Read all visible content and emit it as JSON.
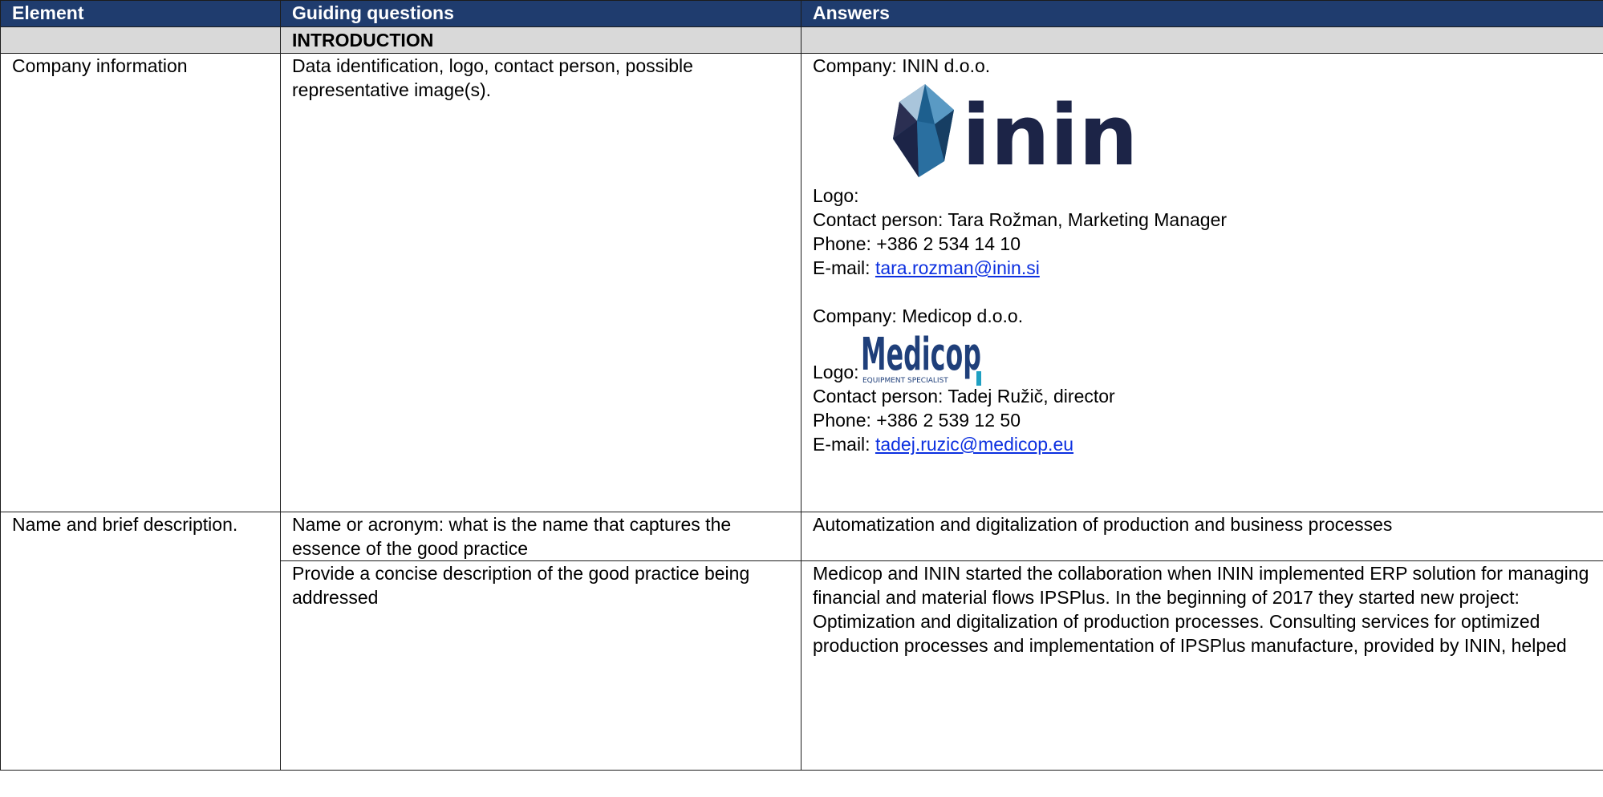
{
  "header": {
    "col1": "Element",
    "col2": "Guiding questions",
    "col3": "Answers"
  },
  "section": {
    "title": "INTRODUCTION"
  },
  "company_info": {
    "element": "Company information",
    "question": "Data identification, logo, contact person, possible representative image(s).",
    "company1": {
      "name_line": "Company: ININ d.o.o.",
      "logo_text": "inin",
      "logo_label": "Logo:",
      "contact": "Contact person: Tara Rožman, Marketing Manager",
      "phone": "Phone: +386 2 534 14 10",
      "email_label": "E-mail: ",
      "email": "tara.rozman@inin.si"
    },
    "company2": {
      "name_line": "Company: Medicop d.o.o.",
      "logo_text": "Medicop",
      "logo_subtext": "EQUIPMENT SPECIALIST",
      "logo_label": "Logo:",
      "contact": "Contact person: Tadej Ružič, director",
      "phone": "Phone: +386 2 539 12 50",
      "email_label": "E-mail: ",
      "email": "tadej.ruzic@medicop.eu"
    }
  },
  "name_desc": {
    "element": "Name and brief description.",
    "q1": "Name or acronym: what is the name that captures the essence of the good practice",
    "a1": "Automatization and digitalization of production and business processes",
    "q2": "Provide a concise description of the good practice being addressed",
    "a2": "Medicop and ININ started the collaboration when ININ implemented ERP solution for managing financial and material flows IPSPlus. In the beginning of 2017 they started new project: Optimization and digitalization of production processes. Consulting services for optimized production processes and implementation of IPSPlus manufacture, provided by ININ, helped"
  },
  "colors": {
    "header_bg": "#1f3c6e",
    "section_bg": "#d9d9d9",
    "link": "#0b2fe0",
    "inin_logo_text": "#1c2447",
    "inin_logo_blue": "#1d5f8e",
    "medicop_logo": "#1f3f7a",
    "medicop_accent": "#1fa0c2"
  }
}
